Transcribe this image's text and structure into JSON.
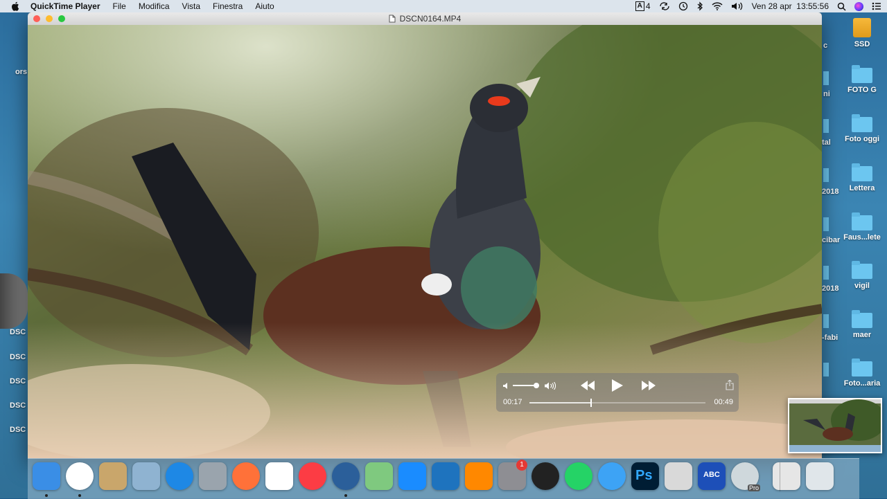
{
  "menubar": {
    "app_name": "QuickTime Player",
    "menus": [
      "File",
      "Modifica",
      "Vista",
      "Finestra",
      "Aiuto"
    ],
    "input_indicator": "A",
    "input_number": "4",
    "datetime": "Ven 28 apr  13:55:56"
  },
  "window": {
    "title": "DSCN0164.MP4"
  },
  "player": {
    "current_time": "00:17",
    "total_time": "00:49",
    "progress_fraction": 0.35,
    "volume_fraction": 0.9
  },
  "desktop_icons": [
    {
      "label": "SSD",
      "kind": "drive"
    },
    {
      "label": "FOTO G",
      "kind": "folder"
    },
    {
      "label": "Foto oggi",
      "kind": "folder"
    },
    {
      "label": "Lettera",
      "kind": "folder"
    },
    {
      "label": "Faus...lete",
      "kind": "folder"
    },
    {
      "label": "vigil",
      "kind": "folder"
    },
    {
      "label": "maer",
      "kind": "folder"
    },
    {
      "label": "Foto...aria",
      "kind": "folder"
    }
  ],
  "desktop_cut_labels": [
    "c",
    "ni",
    "tal",
    "2018",
    "cibar",
    "2018",
    "-fabi"
  ],
  "left_labels": [
    "ors",
    "DSC",
    "DSC",
    "DSC",
    "DSC",
    "DSC"
  ],
  "dock": {
    "items": [
      {
        "name": "finder",
        "color": "#3a8ee6"
      },
      {
        "name": "chrome",
        "color": "#ffffff"
      },
      {
        "name": "preview-bird",
        "color": "#c9a66b"
      },
      {
        "name": "image-capture",
        "color": "#8fb3d1"
      },
      {
        "name": "safari",
        "color": "#1e88e5"
      },
      {
        "name": "launchpad",
        "color": "#9aa4ad"
      },
      {
        "name": "firefox",
        "color": "#ff7139"
      },
      {
        "name": "photos",
        "color": "#ffffff"
      },
      {
        "name": "music",
        "color": "#fc3c44"
      },
      {
        "name": "quicktime",
        "color": "#2b5f9a"
      },
      {
        "name": "maps",
        "color": "#7fc97f"
      },
      {
        "name": "app-store",
        "color": "#1a8cff"
      },
      {
        "name": "word-w",
        "color": "#1e73be"
      },
      {
        "name": "vlc",
        "color": "#ff8800"
      },
      {
        "name": "system-preferences",
        "color": "#8e8e93"
      },
      {
        "name": "camera-lens",
        "color": "#222222"
      },
      {
        "name": "whatsapp",
        "color": "#25d366"
      },
      {
        "name": "messages",
        "color": "#3da3f5"
      },
      {
        "name": "photoshop",
        "color": "#001d34"
      },
      {
        "name": "calculator",
        "color": "#d9d9d9"
      },
      {
        "name": "abc-app",
        "color": "#1d4fb8"
      },
      {
        "name": "google-earth-pro",
        "color": "#cfd8dc"
      },
      {
        "name": "finder-window",
        "color": "#e6e6e6"
      },
      {
        "name": "trash",
        "color": "#e0e6ea"
      }
    ],
    "syspref_badge": "1",
    "abc_text": "ABC",
    "ps_text": "Ps",
    "pro_text": "Pro"
  }
}
